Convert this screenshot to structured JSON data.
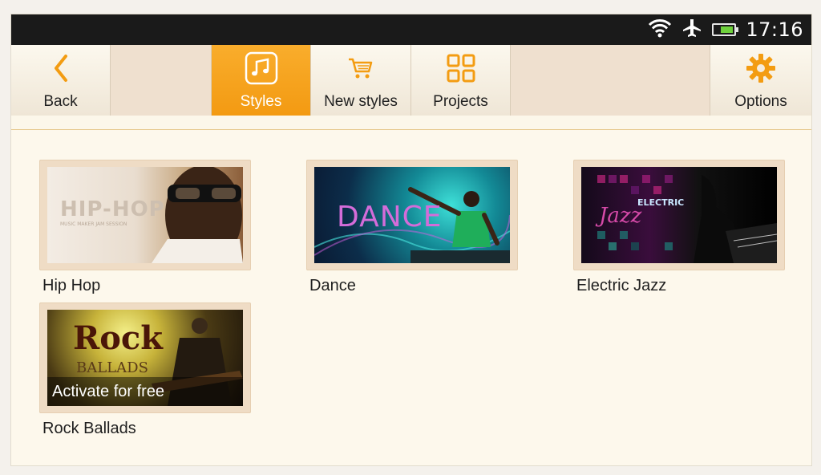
{
  "status_bar": {
    "time": "17:16",
    "icons": [
      "wifi-icon",
      "airplane-mode-icon",
      "battery-icon"
    ],
    "battery_level": 0.7
  },
  "toolbar": {
    "back": {
      "label": "Back",
      "icon": "chevron-left-icon"
    },
    "styles": {
      "label": "Styles",
      "icon": "music-notes-icon",
      "active": true
    },
    "new_styles": {
      "label": "New styles",
      "icon": "shopping-cart-icon"
    },
    "projects": {
      "label": "Projects",
      "icon": "grid-icon"
    },
    "options": {
      "label": "Options",
      "icon": "gear-icon"
    }
  },
  "colors": {
    "accent": "#f7a21e",
    "icon_orange": "#f39c12",
    "toolbar_bg": "#efe0cf",
    "content_bg": "#fdf8ec"
  },
  "styles": [
    {
      "name": "Hip Hop",
      "art_text": "HIP-HOP",
      "art_subtext": "MUSIC MAKER JAM SESSION"
    },
    {
      "name": "Dance",
      "art_text": "DANCE"
    },
    {
      "name": "Electric Jazz",
      "art_text": "ELECTRIC",
      "art_subtext": "Jazz"
    },
    {
      "name": "Rock Ballads",
      "art_text": "Rock",
      "art_subtext": "BALLADS",
      "overlay": "Activate for free"
    }
  ]
}
